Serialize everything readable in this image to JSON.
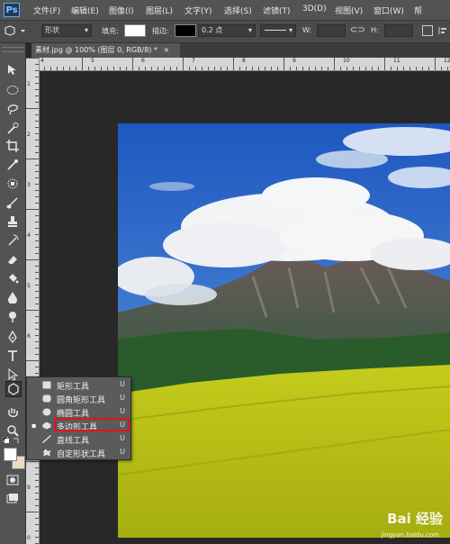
{
  "app": {
    "logo": "Ps"
  },
  "menu": [
    "文件(F)",
    "编辑(E)",
    "图像(I)",
    "图层(L)",
    "文字(Y)",
    "选择(S)",
    "滤镜(T)",
    "3D(D)",
    "视图(V)",
    "窗口(W)",
    "帮"
  ],
  "options": {
    "mode": "形状",
    "fill_label": "填充:",
    "stroke_label": "描边:",
    "stroke_width": "0.2 点",
    "w_label": "W:",
    "h_label": "H:"
  },
  "document_tab": {
    "title": "素材.jpg @ 100% (图层 0, RGB/8) *",
    "close": "×"
  },
  "ruler_numbers": {
    "horizontal": [
      "4",
      "5",
      "6",
      "7",
      "8",
      "9",
      "10",
      "11",
      "12"
    ],
    "vertical": [
      "1",
      "2",
      "3",
      "4",
      "5",
      "6",
      "7",
      "8",
      "9",
      "0"
    ]
  },
  "flyout": {
    "items": [
      {
        "label": "矩形工具",
        "key": "U",
        "icon": "rectangle-icon",
        "active": false
      },
      {
        "label": "圆角矩形工具",
        "key": "U",
        "icon": "rounded-rectangle-icon",
        "active": false
      },
      {
        "label": "椭圆工具",
        "key": "U",
        "icon": "ellipse-icon",
        "active": false
      },
      {
        "label": "多边形工具",
        "key": "U",
        "icon": "polygon-icon",
        "active": true
      },
      {
        "label": "直线工具",
        "key": "U",
        "icon": "line-icon",
        "active": false
      },
      {
        "label": "自定形状工具",
        "key": "U",
        "icon": "custom-shape-icon",
        "active": false
      }
    ]
  },
  "watermark": {
    "text": "Bai 经验",
    "sub": "jingyan.baidu.com"
  },
  "colors": {
    "highlight": "#e0141e",
    "sky": "#2a63c4",
    "field": "#cfd61e"
  }
}
